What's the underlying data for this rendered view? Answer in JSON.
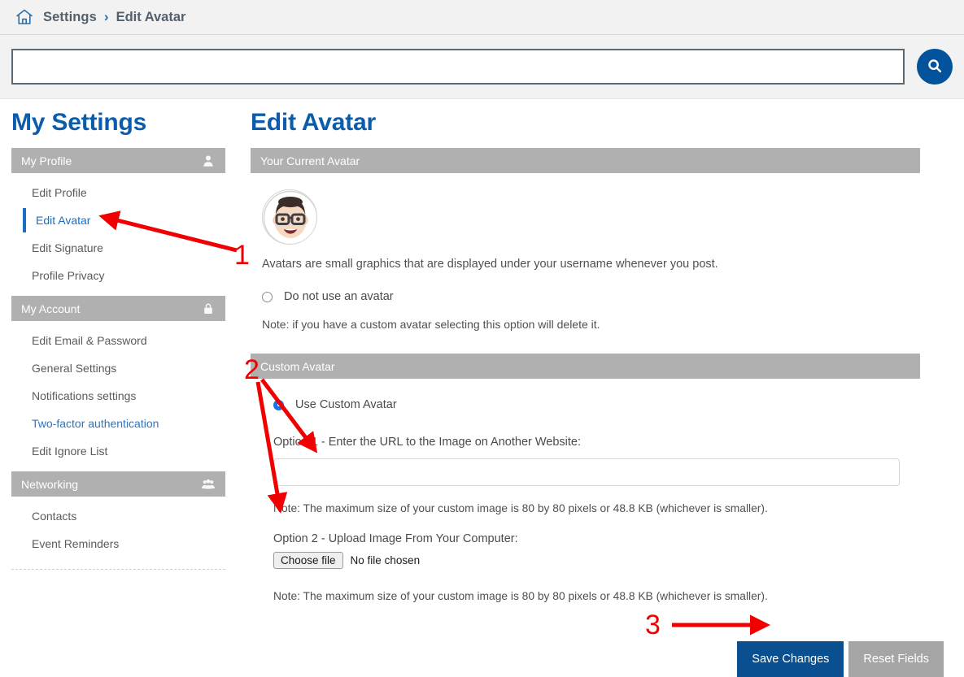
{
  "breadcrumb": {
    "home_icon": "home-icon",
    "items": [
      "Settings",
      "Edit Avatar"
    ],
    "separator": "›"
  },
  "search": {
    "value": "",
    "placeholder": "",
    "button_icon": "search-icon"
  },
  "sidebar": {
    "title": "My Settings",
    "groups": [
      {
        "label": "My Profile",
        "icon": "person-icon",
        "items": [
          {
            "label": "Edit Profile",
            "state": "normal"
          },
          {
            "label": "Edit Avatar",
            "state": "active"
          },
          {
            "label": "Edit Signature",
            "state": "normal"
          },
          {
            "label": "Profile Privacy",
            "state": "normal"
          }
        ]
      },
      {
        "label": "My Account",
        "icon": "lock-icon",
        "items": [
          {
            "label": "Edit Email & Password",
            "state": "normal"
          },
          {
            "label": "General Settings",
            "state": "normal"
          },
          {
            "label": "Notifications settings",
            "state": "normal"
          },
          {
            "label": "Two-factor authentication",
            "state": "link"
          },
          {
            "label": "Edit Ignore List",
            "state": "normal"
          }
        ]
      },
      {
        "label": "Networking",
        "icon": "people-icon",
        "items": [
          {
            "label": "Contacts",
            "state": "normal"
          },
          {
            "label": "Event Reminders",
            "state": "normal"
          }
        ]
      }
    ]
  },
  "main": {
    "title": "Edit Avatar",
    "current_avatar_section": {
      "header": "Your Current Avatar",
      "avatar_icon": "memoji-avatar",
      "description": "Avatars are small graphics that are displayed under your username whenever you post.",
      "no_avatar_option": {
        "label": "Do not use an avatar",
        "checked": false
      },
      "no_avatar_note": "Note: if you have a custom avatar selecting this option will delete it."
    },
    "custom_avatar_section": {
      "header": "Custom Avatar",
      "use_custom_option": {
        "label": "Use Custom Avatar",
        "checked": true
      },
      "option1_label": "Option 1 - Enter the URL to the Image on Another Website:",
      "option1_value": "",
      "option1_placeholder": "",
      "option1_note": "Note: The maximum size of your custom image is 80 by 80 pixels or 48.8 KB (whichever is smaller).",
      "option2_label": "Option 2 - Upload Image From Your Computer:",
      "file_button_label": "Choose file",
      "file_status": "No file chosen",
      "option2_note": "Note: The maximum size of your custom image is 80 by 80 pixels or 48.8 KB (whichever is smaller)."
    },
    "actions": {
      "save_label": "Save Changes",
      "reset_label": "Reset Fields"
    }
  },
  "annotations": {
    "color": "#f00000",
    "markers": [
      {
        "number": "1",
        "target": "sidebar-item-edit-avatar"
      },
      {
        "number": "2",
        "target": "custom-avatar-url-and-upload"
      },
      {
        "number": "3",
        "target": "save-changes-button"
      }
    ]
  },
  "colors": {
    "brand_blue": "#0b5cab",
    "primary_button": "#0a4f8f",
    "secondary_button": "#a5a5a5",
    "section_gray": "#b0b0b0",
    "annotation_red": "#f00000"
  }
}
